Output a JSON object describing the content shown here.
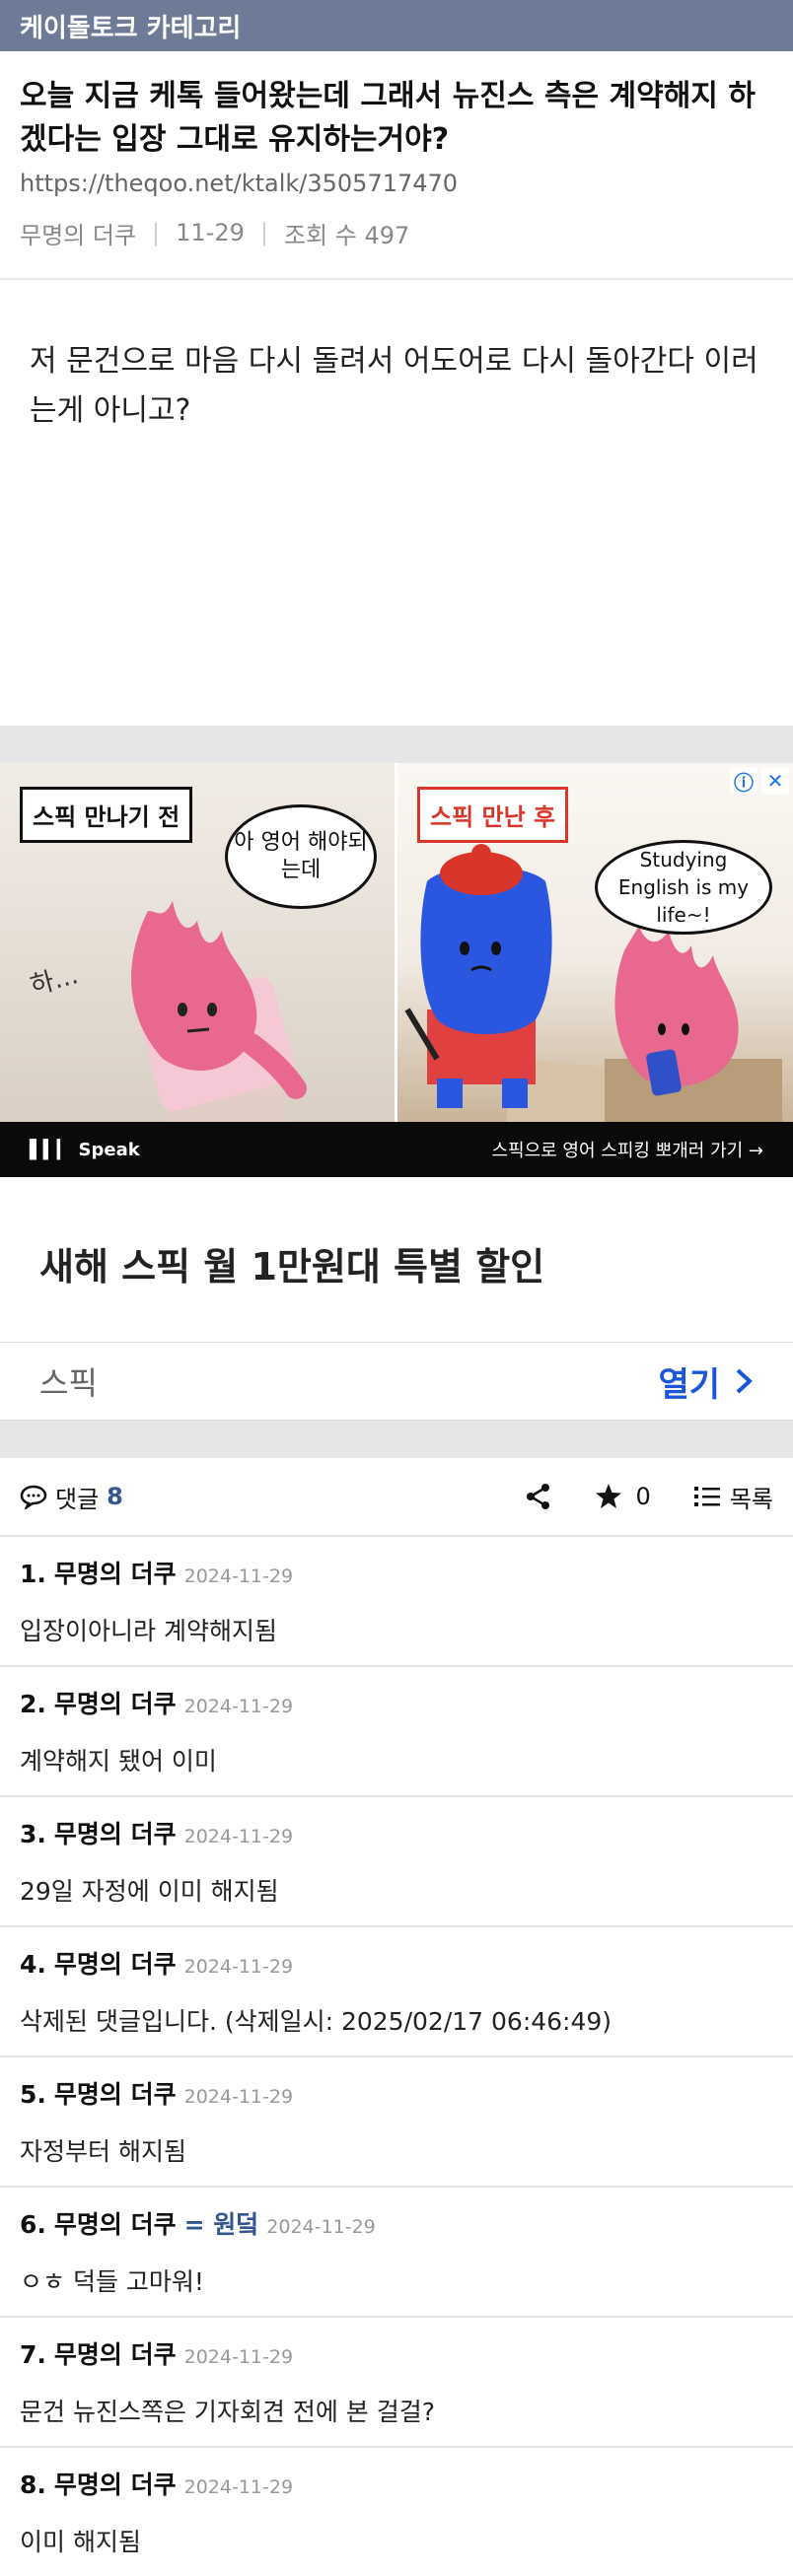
{
  "topbar": {
    "category": "케이돌토크 카테고리"
  },
  "post": {
    "title": "오늘 지금 케톡 들어왔는데 그래서 뉴진스 측은 계약해지 하겠다는 입장 그대로 유지하는거야?",
    "url": "https://theqoo.net/ktalk/3505717470",
    "author": "무명의 더쿠",
    "date": "11-29",
    "views_label": "조회 수 497",
    "body": "저 문건으로 마음 다시 돌려서 어도어로 다시 돌아간다 이러는게 아니고?"
  },
  "ad": {
    "left_tag": "스픽 만나기 전",
    "left_bubble": "아 영어 해야되는데",
    "left_sigh": "하...",
    "right_tag": "스픽 만난 후",
    "right_bubble": "Studying English is my life~!",
    "footer_brand": "Speak",
    "footer_cta": "스픽으로 영어 스피킹 뽀개러 가기 →",
    "headline": "새해 스픽 월 1만원대 특별 할인",
    "brand": "스픽",
    "open_label": "열기"
  },
  "comments_bar": {
    "label": "댓글",
    "count": "8",
    "star_count": "0",
    "list_label": "목록"
  },
  "comments": [
    {
      "num": "1.",
      "author": "무명의 더쿠",
      "badge": "",
      "date": "2024-11-29",
      "text": "입장이아니라 계약해지됨"
    },
    {
      "num": "2.",
      "author": "무명의 더쿠",
      "badge": "",
      "date": "2024-11-29",
      "text": "계약해지 됐어 이미"
    },
    {
      "num": "3.",
      "author": "무명의 더쿠",
      "badge": "",
      "date": "2024-11-29",
      "text": "29일 자정에 이미 해지됨"
    },
    {
      "num": "4.",
      "author": "무명의 더쿠",
      "badge": "",
      "date": "2024-11-29",
      "text": "삭제된 댓글입니다. (삭제일시: 2025/02/17 06:46:49)"
    },
    {
      "num": "5.",
      "author": "무명의 더쿠",
      "badge": "",
      "date": "2024-11-29",
      "text": "자정부터 해지됨"
    },
    {
      "num": "6.",
      "author": "무명의 더쿠",
      "badge": "= 원덬",
      "date": "2024-11-29",
      "text": "ㅇㅎ 덕들 고마워!"
    },
    {
      "num": "7.",
      "author": "무명의 더쿠",
      "badge": "",
      "date": "2024-11-29",
      "text": "문건 뉴진스쪽은 기자회견 전에 본 걸걸?"
    },
    {
      "num": "8.",
      "author": "무명의 더쿠",
      "badge": "",
      "date": "2024-11-29",
      "text": "이미 해지됨"
    }
  ],
  "colors": {
    "topbar": "#6e7b96",
    "accent": "#33568d",
    "ad_open": "#1a56db",
    "tag_red": "#d9352a"
  }
}
